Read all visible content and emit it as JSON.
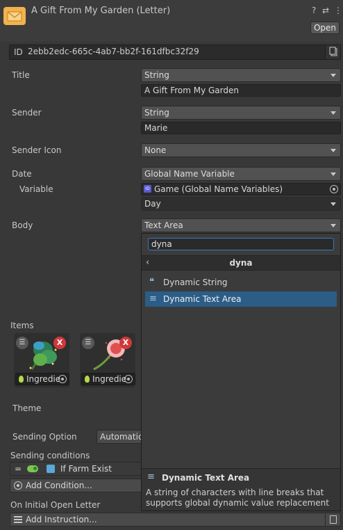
{
  "header": {
    "title": "A Gift From My Garden (Letter)",
    "help_icon": "?",
    "settings_icon": "⇄",
    "menu_icon": "⋮",
    "open_label": "Open"
  },
  "id": {
    "label": "ID",
    "value": "2ebb2edc-665c-4ab7-bb2f-161dfbc32f29"
  },
  "fields": {
    "title": {
      "label": "Title",
      "type": "String",
      "value": "A Gift From My Garden"
    },
    "sender": {
      "label": "Sender",
      "type": "String",
      "value": "Marie"
    },
    "sender_icon": {
      "label": "Sender Icon",
      "type": "None"
    },
    "date": {
      "label": "Date",
      "type": "Global Name Variable",
      "variable_label": "Variable",
      "variable_value": "Game (Global Name Variables)",
      "variable_icon": "ID",
      "sub_type": "Day"
    },
    "body": {
      "label": "Body",
      "type": "Text Area"
    }
  },
  "popup": {
    "search": "dyna",
    "crumb": "dyna",
    "back": "‹",
    "options": [
      {
        "icon": "❝",
        "label": "Dynamic String"
      },
      {
        "icon": "≡",
        "label": "Dynamic Text Area"
      }
    ],
    "selected_index": 1,
    "desc_title": "Dynamic Text Area",
    "desc_text": "A string of characters with line breaks that supports global dynamic value replacement"
  },
  "items": {
    "label": "Items",
    "cards": [
      {
        "name": "Ingredie",
        "list_icon": "☰",
        "remove": "X"
      },
      {
        "name": "Ingredie",
        "list_icon": "☰",
        "remove": "X"
      }
    ]
  },
  "theme": {
    "label": "Theme"
  },
  "sending_option": {
    "label": "Sending Option",
    "value": "Automatic"
  },
  "conditions": {
    "label": "Sending conditions",
    "equals": "=",
    "item": "If Farm Exist",
    "add": "Add Condition..."
  },
  "instructions": {
    "label": "On Initial Open Letter",
    "add": "Add Instruction..."
  },
  "colors": {
    "accent": "#2c5d87",
    "envelope": "#f2b24c",
    "remove": "#d0383a",
    "toggle": "#7ec44f"
  }
}
